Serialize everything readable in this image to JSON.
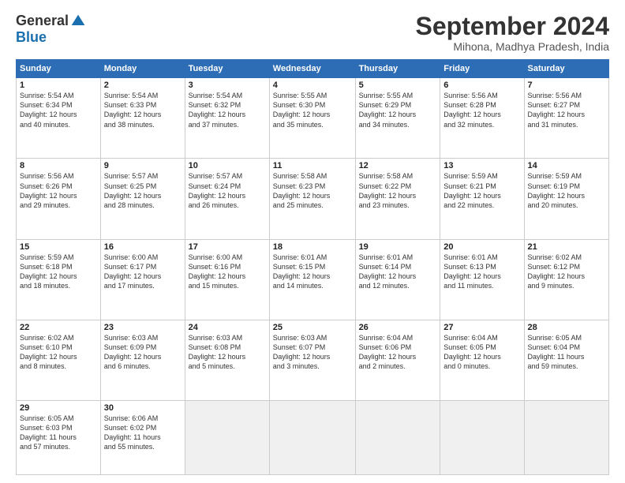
{
  "logo": {
    "general": "General",
    "blue": "Blue"
  },
  "title": "September 2024",
  "location": "Mihona, Madhya Pradesh, India",
  "headers": [
    "Sunday",
    "Monday",
    "Tuesday",
    "Wednesday",
    "Thursday",
    "Friday",
    "Saturday"
  ],
  "weeks": [
    [
      {
        "day": "1",
        "info": "Sunrise: 5:54 AM\nSunset: 6:34 PM\nDaylight: 12 hours\nand 40 minutes."
      },
      {
        "day": "2",
        "info": "Sunrise: 5:54 AM\nSunset: 6:33 PM\nDaylight: 12 hours\nand 38 minutes."
      },
      {
        "day": "3",
        "info": "Sunrise: 5:54 AM\nSunset: 6:32 PM\nDaylight: 12 hours\nand 37 minutes."
      },
      {
        "day": "4",
        "info": "Sunrise: 5:55 AM\nSunset: 6:30 PM\nDaylight: 12 hours\nand 35 minutes."
      },
      {
        "day": "5",
        "info": "Sunrise: 5:55 AM\nSunset: 6:29 PM\nDaylight: 12 hours\nand 34 minutes."
      },
      {
        "day": "6",
        "info": "Sunrise: 5:56 AM\nSunset: 6:28 PM\nDaylight: 12 hours\nand 32 minutes."
      },
      {
        "day": "7",
        "info": "Sunrise: 5:56 AM\nSunset: 6:27 PM\nDaylight: 12 hours\nand 31 minutes."
      }
    ],
    [
      {
        "day": "8",
        "info": "Sunrise: 5:56 AM\nSunset: 6:26 PM\nDaylight: 12 hours\nand 29 minutes."
      },
      {
        "day": "9",
        "info": "Sunrise: 5:57 AM\nSunset: 6:25 PM\nDaylight: 12 hours\nand 28 minutes."
      },
      {
        "day": "10",
        "info": "Sunrise: 5:57 AM\nSunset: 6:24 PM\nDaylight: 12 hours\nand 26 minutes."
      },
      {
        "day": "11",
        "info": "Sunrise: 5:58 AM\nSunset: 6:23 PM\nDaylight: 12 hours\nand 25 minutes."
      },
      {
        "day": "12",
        "info": "Sunrise: 5:58 AM\nSunset: 6:22 PM\nDaylight: 12 hours\nand 23 minutes."
      },
      {
        "day": "13",
        "info": "Sunrise: 5:59 AM\nSunset: 6:21 PM\nDaylight: 12 hours\nand 22 minutes."
      },
      {
        "day": "14",
        "info": "Sunrise: 5:59 AM\nSunset: 6:19 PM\nDaylight: 12 hours\nand 20 minutes."
      }
    ],
    [
      {
        "day": "15",
        "info": "Sunrise: 5:59 AM\nSunset: 6:18 PM\nDaylight: 12 hours\nand 18 minutes."
      },
      {
        "day": "16",
        "info": "Sunrise: 6:00 AM\nSunset: 6:17 PM\nDaylight: 12 hours\nand 17 minutes."
      },
      {
        "day": "17",
        "info": "Sunrise: 6:00 AM\nSunset: 6:16 PM\nDaylight: 12 hours\nand 15 minutes."
      },
      {
        "day": "18",
        "info": "Sunrise: 6:01 AM\nSunset: 6:15 PM\nDaylight: 12 hours\nand 14 minutes."
      },
      {
        "day": "19",
        "info": "Sunrise: 6:01 AM\nSunset: 6:14 PM\nDaylight: 12 hours\nand 12 minutes."
      },
      {
        "day": "20",
        "info": "Sunrise: 6:01 AM\nSunset: 6:13 PM\nDaylight: 12 hours\nand 11 minutes."
      },
      {
        "day": "21",
        "info": "Sunrise: 6:02 AM\nSunset: 6:12 PM\nDaylight: 12 hours\nand 9 minutes."
      }
    ],
    [
      {
        "day": "22",
        "info": "Sunrise: 6:02 AM\nSunset: 6:10 PM\nDaylight: 12 hours\nand 8 minutes."
      },
      {
        "day": "23",
        "info": "Sunrise: 6:03 AM\nSunset: 6:09 PM\nDaylight: 12 hours\nand 6 minutes."
      },
      {
        "day": "24",
        "info": "Sunrise: 6:03 AM\nSunset: 6:08 PM\nDaylight: 12 hours\nand 5 minutes."
      },
      {
        "day": "25",
        "info": "Sunrise: 6:03 AM\nSunset: 6:07 PM\nDaylight: 12 hours\nand 3 minutes."
      },
      {
        "day": "26",
        "info": "Sunrise: 6:04 AM\nSunset: 6:06 PM\nDaylight: 12 hours\nand 2 minutes."
      },
      {
        "day": "27",
        "info": "Sunrise: 6:04 AM\nSunset: 6:05 PM\nDaylight: 12 hours\nand 0 minutes."
      },
      {
        "day": "28",
        "info": "Sunrise: 6:05 AM\nSunset: 6:04 PM\nDaylight: 11 hours\nand 59 minutes."
      }
    ],
    [
      {
        "day": "29",
        "info": "Sunrise: 6:05 AM\nSunset: 6:03 PM\nDaylight: 11 hours\nand 57 minutes."
      },
      {
        "day": "30",
        "info": "Sunrise: 6:06 AM\nSunset: 6:02 PM\nDaylight: 11 hours\nand 55 minutes."
      },
      {
        "day": "",
        "info": ""
      },
      {
        "day": "",
        "info": ""
      },
      {
        "day": "",
        "info": ""
      },
      {
        "day": "",
        "info": ""
      },
      {
        "day": "",
        "info": ""
      }
    ]
  ]
}
